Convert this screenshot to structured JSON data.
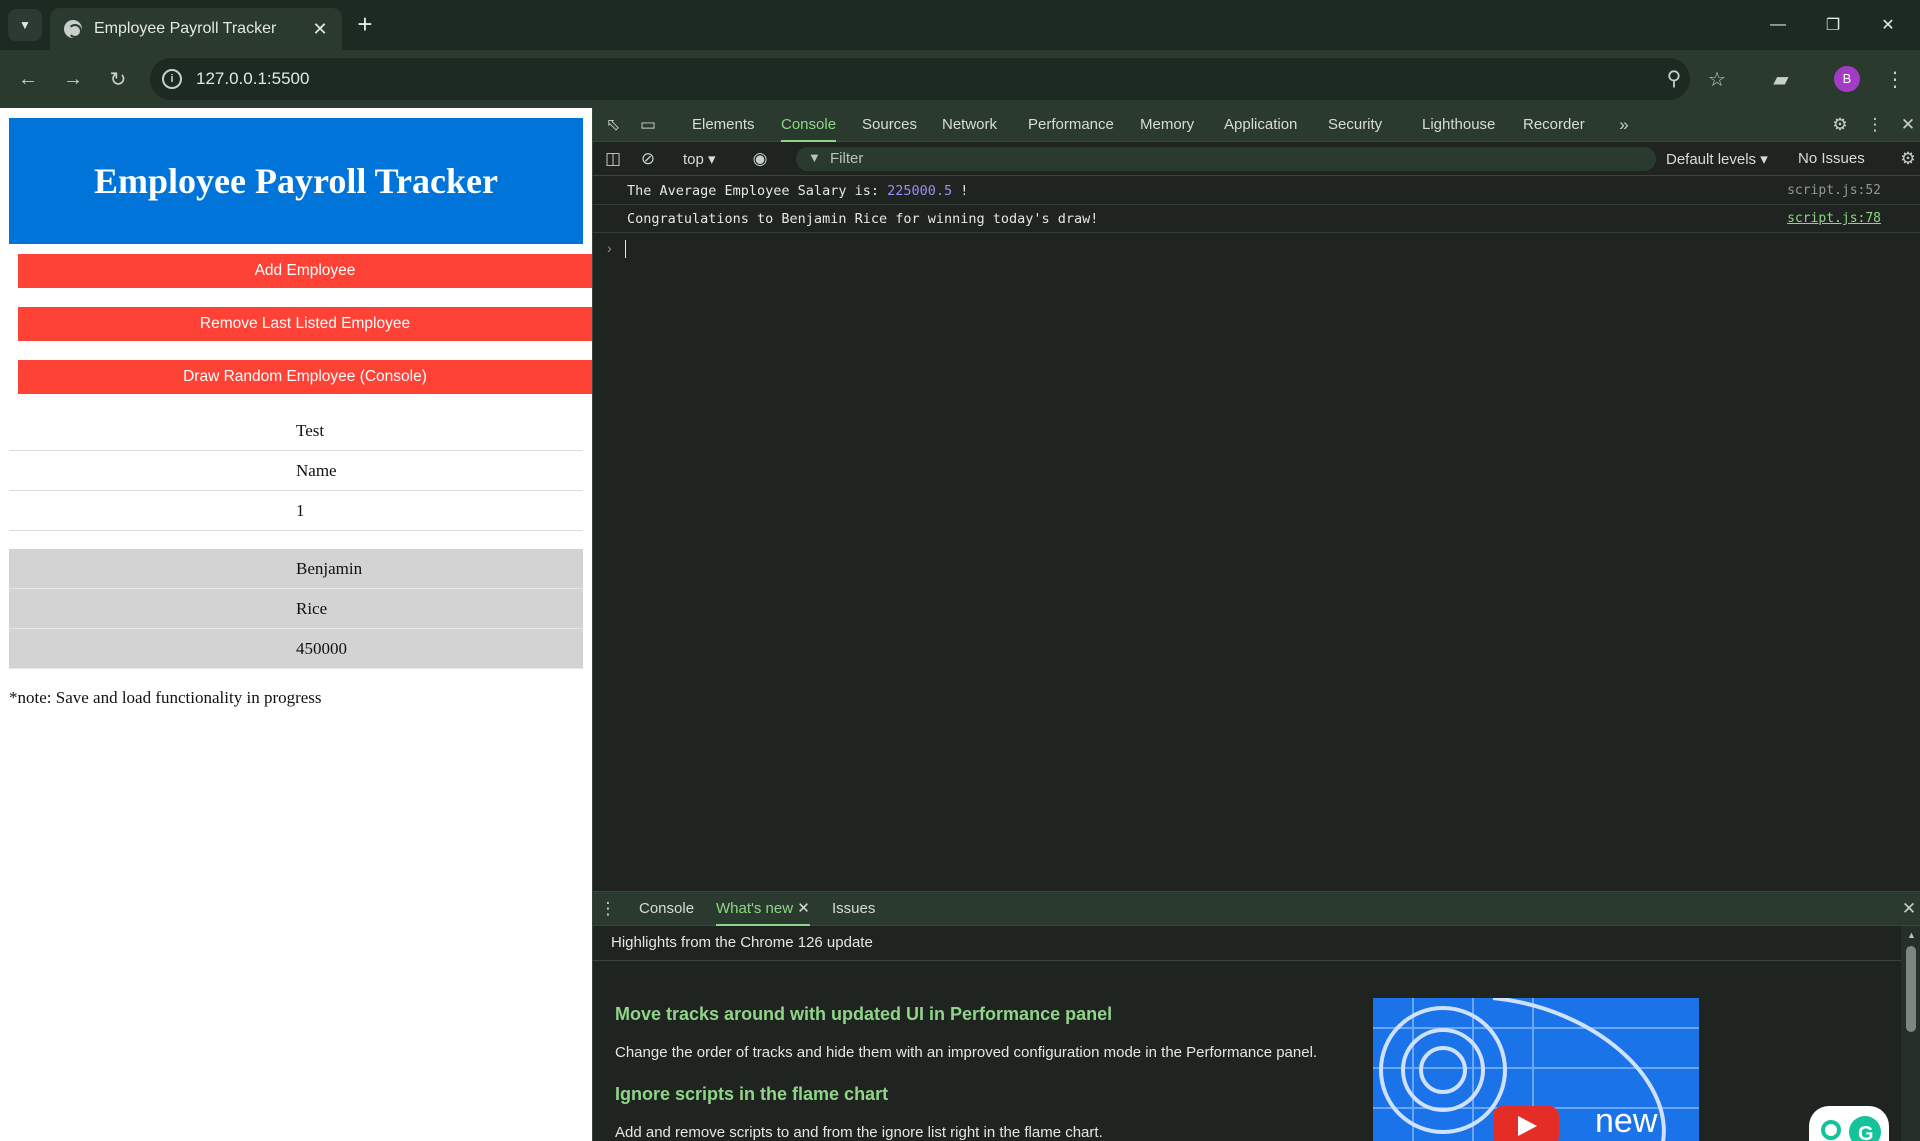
{
  "browser": {
    "tab_title": "Employee Payroll Tracker",
    "url": "127.0.0.1:5500",
    "profile_initial": "B"
  },
  "page": {
    "title": "Employee Payroll Tracker",
    "buttons": {
      "add": "Add Employee",
      "remove": "Remove Last Listed Employee",
      "draw": "Draw Random Employee (Console)"
    },
    "employees": [
      {
        "first": "Test",
        "last": "Name",
        "salary": "1"
      },
      {
        "first": "Benjamin",
        "last": "Rice",
        "salary": "450000"
      }
    ],
    "note": "*note: Save and load functionality in progress",
    "colors": {
      "header": "#0074d9",
      "button": "#ff4136",
      "row_alt": "#d3d3d3"
    }
  },
  "devtools": {
    "tabs": [
      "Elements",
      "Console",
      "Sources",
      "Network",
      "Performance",
      "Memory",
      "Application",
      "Security",
      "Lighthouse",
      "Recorder"
    ],
    "active_tab": "Console",
    "context": "top",
    "filter_placeholder": "Filter",
    "levels": "Default levels",
    "issues": "No Issues",
    "console_lines": [
      {
        "prefix": "The Average Employee Salary is: ",
        "value": "225000.5",
        "suffix": " !",
        "source": "script.js:52"
      },
      {
        "prefix": "Congratulations to Benjamin Rice for winning today's draw!",
        "value": "",
        "suffix": "",
        "source": "script.js:78"
      }
    ],
    "drawer": {
      "tabs": [
        "Console",
        "What's new",
        "Issues"
      ],
      "active_tab": "What's new",
      "subtitle": "Highlights from the Chrome 126 update",
      "items": [
        {
          "heading": "Move tracks around with updated UI in Performance panel",
          "text": "Change the order of tracks and hide them with an improved configuration mode in the Performance panel."
        },
        {
          "heading": "Ignore scripts in the flame chart",
          "text": "Add and remove scripts to and from the ignore list right in the flame chart."
        }
      ],
      "video_label": "new"
    }
  }
}
